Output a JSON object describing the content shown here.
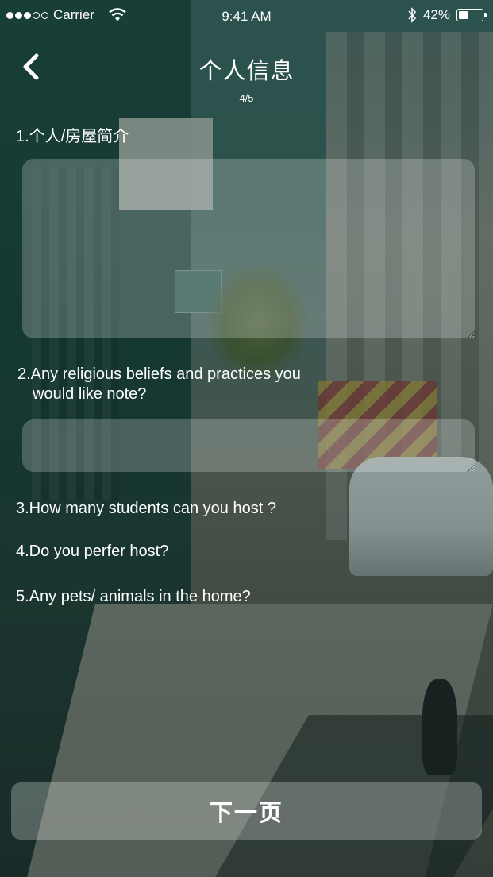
{
  "status_bar": {
    "carrier": "Carrier",
    "time": "9:41 AM",
    "battery_percent_text": "42%",
    "battery_level": 0.42,
    "signal_bars_filled": 3,
    "signal_bars_total": 5
  },
  "nav": {
    "back_icon": "chevron-left-icon",
    "title": "个人信息",
    "page_indicator": "4/5"
  },
  "form": {
    "q1_label": "1.个人/房屋简介",
    "q1_value": "",
    "q2_label_line1": "2.Any religious beliefs and practices you",
    "q2_label_line2": "would like note?",
    "q2_value": "",
    "q3_label": "3.How many students can you host ?",
    "q4_label": "4.Do you perfer host?",
    "q5_label": "5.Any pets/ animals in the home?"
  },
  "footer": {
    "next_label": "下一页"
  },
  "colors": {
    "text": "#ffffff",
    "input_fill": "rgba(255,255,255,0.22)",
    "button_fill": "rgba(225,228,226,0.30)"
  }
}
